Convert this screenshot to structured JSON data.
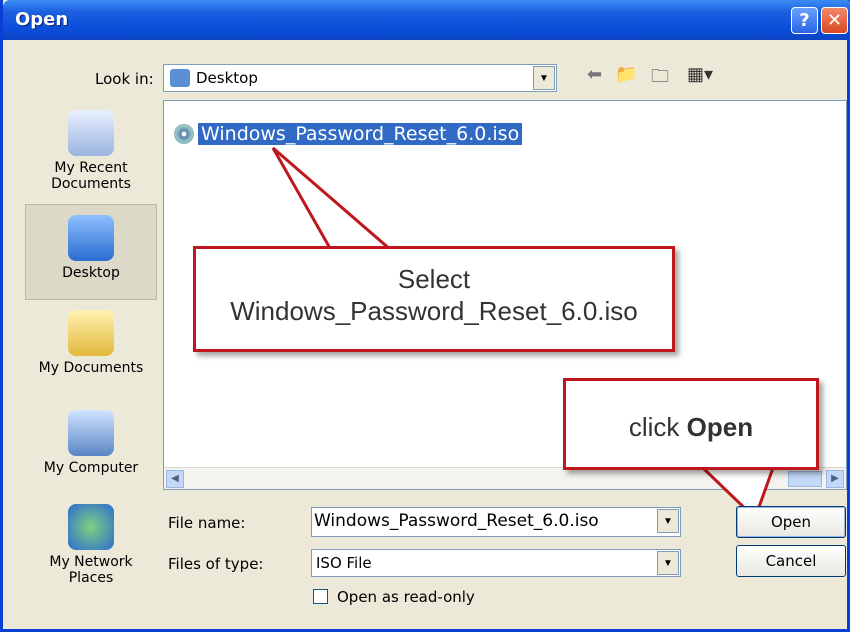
{
  "window": {
    "title": "Open"
  },
  "titlebar": {
    "help_icon": "?",
    "close_icon": "✕"
  },
  "lookin": {
    "label": "Look in:",
    "value": "Desktop"
  },
  "toolbar": {
    "back_icon": "back-arrow-icon",
    "up_icon": "up-folder-icon",
    "new_folder_icon": "new-folder-icon",
    "view_icon": "view-menu-icon"
  },
  "places": [
    {
      "label": "My Recent Documents"
    },
    {
      "label": "Desktop"
    },
    {
      "label": "My Documents"
    },
    {
      "label": "My Computer"
    },
    {
      "label": "My Network Places"
    }
  ],
  "files": [
    {
      "name": "Windows_Password_Reset_6.0.iso"
    }
  ],
  "callouts": {
    "select_line1": "Select",
    "select_line2": "Windows_Password_Reset_6.0.iso",
    "click_prefix": "click",
    "click_bold": "Open"
  },
  "filename": {
    "label": "File name:",
    "value": "Windows_Password_Reset_6.0.iso"
  },
  "filetype": {
    "label": "Files of type:",
    "value": "ISO File"
  },
  "readonly": {
    "label": "Open as read-only"
  },
  "buttons": {
    "open": "Open",
    "cancel": "Cancel"
  },
  "colors": {
    "accent": "#c0161d",
    "selection": "#316ac5",
    "titlebar": "#0a4fdb"
  }
}
